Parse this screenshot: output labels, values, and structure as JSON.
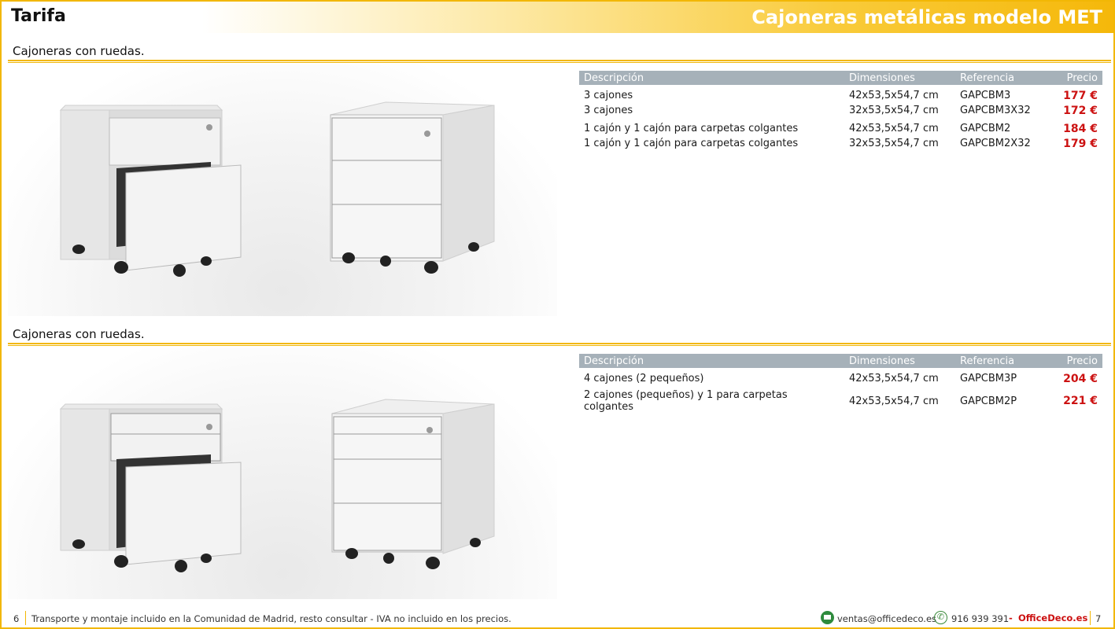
{
  "header": {
    "left_title": "Tarifa",
    "right_title": "Cajoneras metálicas modelo MET"
  },
  "table_headers": {
    "descripcion": "Descripción",
    "dimensiones": "Dimensiones",
    "referencia": "Referencia",
    "precio": "Precio"
  },
  "sections": [
    {
      "title": "Cajoneras con ruedas.",
      "rows": [
        {
          "descripcion": "3 cajones",
          "dimensiones": "42x53,5x54,7 cm",
          "referencia": "GAPCBM3",
          "precio": "177 €"
        },
        {
          "descripcion": "3 cajones",
          "dimensiones": "32x53,5x54,7 cm",
          "referencia": "GAPCBM3X32",
          "precio": "172 €"
        },
        {
          "descripcion": "1 cajón y 1 cajón para carpetas colgantes",
          "dimensiones": "42x53,5x54,7 cm",
          "referencia": "GAPCBM2",
          "precio": "184 €"
        },
        {
          "descripcion": "1 cajón y 1 cajón para carpetas colgantes",
          "dimensiones": "32x53,5x54,7 cm",
          "referencia": "GAPCBM2X32",
          "precio": "179 €"
        }
      ]
    },
    {
      "title": "Cajoneras con ruedas.",
      "rows": [
        {
          "descripcion": "4 cajones (2 pequeños)",
          "dimensiones": "42x53,5x54,7 cm",
          "referencia": "GAPCBM3P",
          "precio": "204 €"
        },
        {
          "descripcion": "2 cajones (pequeños) y 1 para carpetas colgantes",
          "dimensiones": "42x53,5x54,7 cm",
          "referencia": "GAPCBM2P",
          "precio": "221 €"
        }
      ]
    }
  ],
  "footer": {
    "page_left": "6",
    "note": "Transporte y montaje incluido en la Comunidad de Madrid, resto consultar - IVA no incluido en los precios.",
    "email": "ventas@officedeco.es",
    "phone": "916 939 391",
    "dash": "-",
    "brand": "OfficeDeco.es",
    "page_right": "7"
  }
}
